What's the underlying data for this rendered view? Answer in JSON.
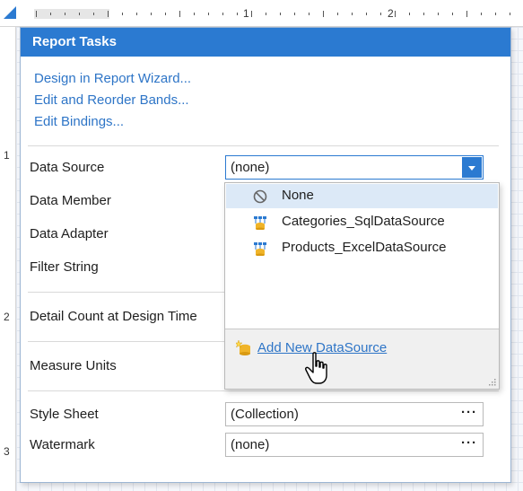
{
  "ruler": {
    "marks": [
      "1",
      "2"
    ],
    "left_marks": [
      "1",
      "2",
      "3"
    ]
  },
  "panel": {
    "title": "Report Tasks",
    "links": [
      "Design in Report Wizard...",
      "Edit and Reorder Bands...",
      "Edit Bindings..."
    ],
    "labels": {
      "data_source": "Data Source",
      "data_member": "Data Member",
      "data_adapter": "Data Adapter",
      "filter_string": "Filter String",
      "detail_count": "Detail Count at Design Time",
      "measure_units": "Measure Units",
      "style_sheet": "Style Sheet",
      "watermark": "Watermark"
    },
    "values": {
      "data_source": "(none)",
      "style_sheet": "(Collection)",
      "watermark": "(none)"
    },
    "ellipsis": "···"
  },
  "dropdown": {
    "items": [
      {
        "label": "None",
        "icon": "none-icon",
        "selected": true
      },
      {
        "label": "Categories_SqlDataSource",
        "icon": "datasource-icon",
        "selected": false
      },
      {
        "label": "Products_ExcelDataSource",
        "icon": "datasource-icon",
        "selected": false
      }
    ],
    "add_label": "Add New DataSource"
  },
  "colors": {
    "accent": "#2b7ad1",
    "link": "#2e75c7",
    "selection": "#dce9f7"
  }
}
